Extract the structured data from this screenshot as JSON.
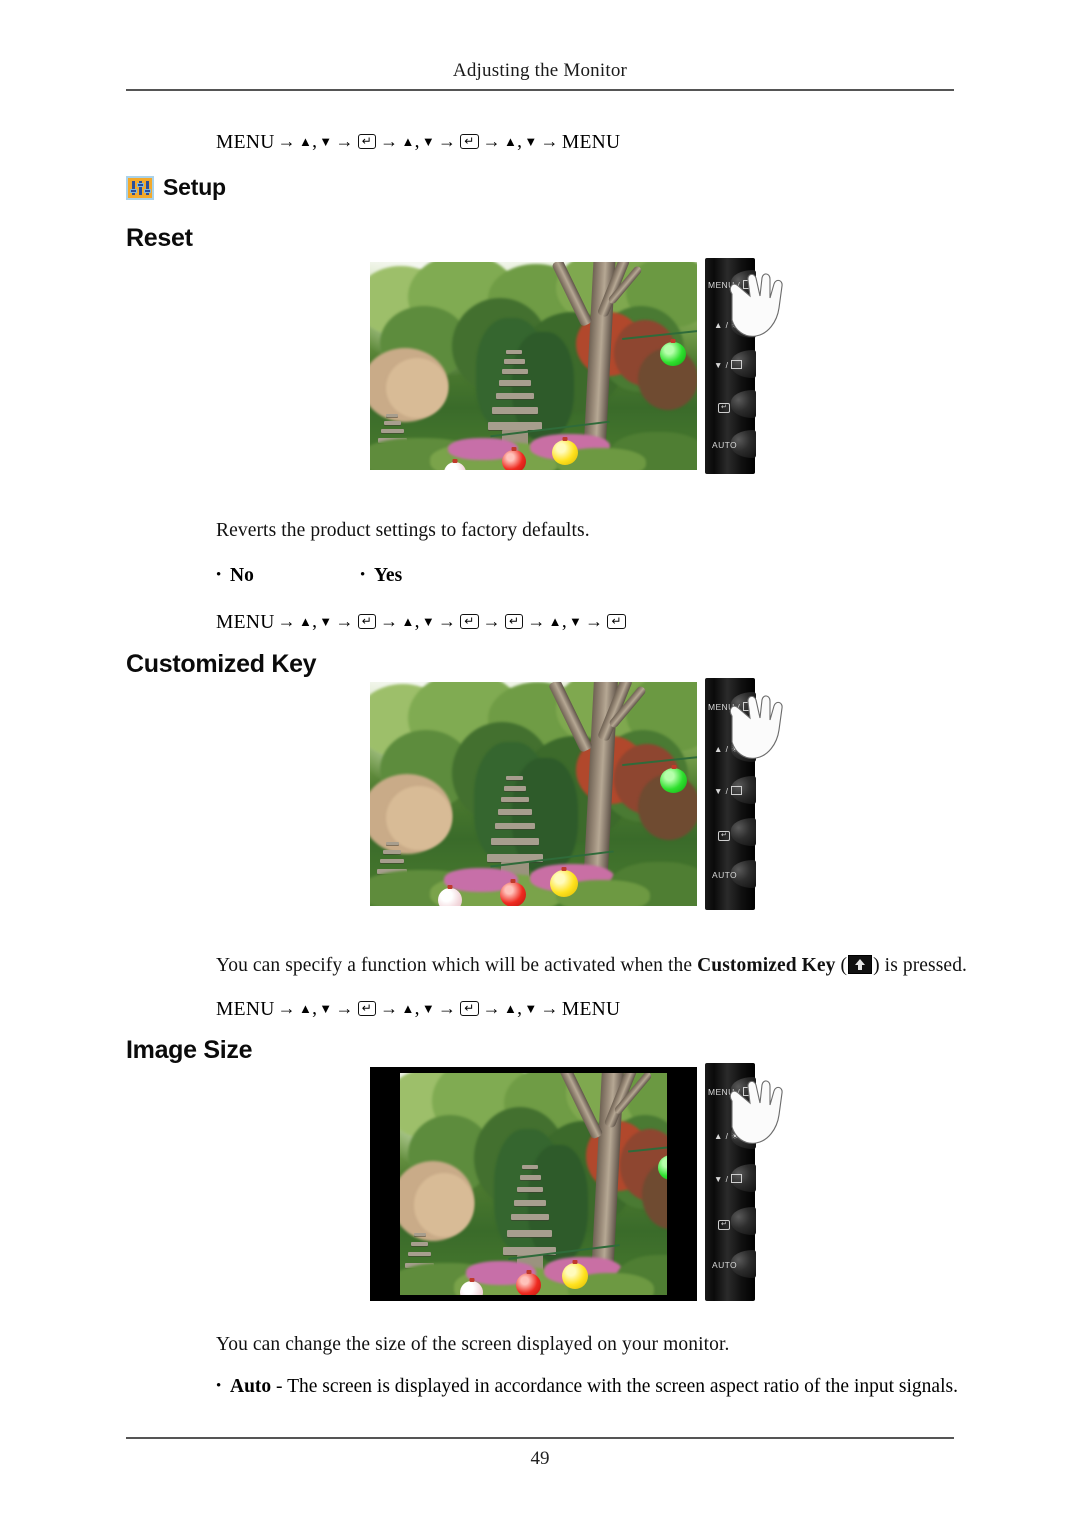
{
  "document": {
    "running_head": "Adjusting the Monitor",
    "page_number": "49"
  },
  "nav_paths": {
    "setup_reset_entry": "MENU → ▲ , ▼ → ↵ → ▲ , ▼ → ↵ → ▲ , ▼ → MENU",
    "reset_confirm": "MENU → ▲ , ▼ → ↵ → ▲ , ▼ → ↵ → ↵ → ▲ , ▼ → ↵",
    "customized_key": "MENU → ▲ , ▼ → ↵ → ▲ , ▼ → ↵ → ▲ , ▼ → MENU"
  },
  "headings": {
    "setup": "Setup",
    "setup_icon": "setup-sliders-icon",
    "reset": "Reset",
    "customized_key": "Customized Key",
    "image_size": "Image Size"
  },
  "sections": {
    "reset": {
      "description": "Reverts the product settings to factory defaults.",
      "options": [
        "No",
        "Yes"
      ]
    },
    "customized_key": {
      "description_before": "You can specify a function which will be activated when the ",
      "description_bold": "Customized Key",
      "description_paren_open": " (",
      "description_paren_close": ") is pressed.",
      "inline_icon": "customized-key-icon"
    },
    "image_size": {
      "description": "You can change the size of the screen displayed on your monitor.",
      "bullets": [
        {
          "term": "Auto",
          "text": " - The screen is displayed in accordance with the screen aspect ratio of the input signals."
        }
      ]
    }
  },
  "monitor_panel": {
    "buttons": [
      {
        "label": "MENU /",
        "icon": "menu-grid-icon",
        "name": "menu-button"
      },
      {
        "label": "▲ /",
        "icon": "brightness-sun-icon",
        "name": "up-brightness-button"
      },
      {
        "label": "▼ /",
        "icon": "mode-box-icon",
        "name": "down-mode-button"
      },
      {
        "label": "",
        "icon": "enter-icon",
        "name": "enter-button"
      },
      {
        "label": "AUTO",
        "icon": "",
        "name": "auto-button"
      }
    ],
    "hand_cursor": "hand-pointing-icon"
  },
  "figures": [
    {
      "name": "reset-monitor-figure",
      "caption_scene": "Korean garden with stone pagodas, lanterns and trees",
      "letterboxed": false
    },
    {
      "name": "customized-key-monitor-figure",
      "caption_scene": "Korean garden with stone pagodas, lanterns and trees",
      "letterboxed": false
    },
    {
      "name": "image-size-monitor-figure",
      "caption_scene": "Korean garden with stone pagodas, lanterns and trees",
      "letterboxed": true
    }
  ],
  "colors": {
    "icon_orange": "#F2A92B",
    "icon_blue": "#2A4F9B",
    "rule_gray": "#555555"
  }
}
